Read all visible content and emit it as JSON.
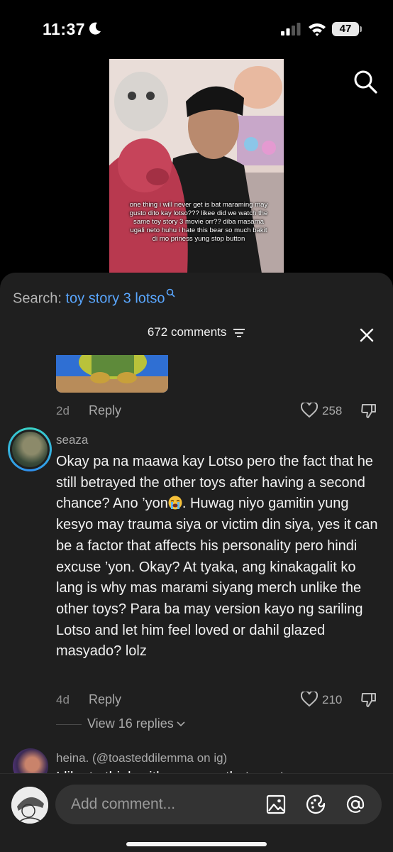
{
  "status_bar": {
    "time": "11:37",
    "battery": "47"
  },
  "video": {
    "caption": "one thing i will never get is bat maraming may gusto dito kay lotso??? likee did we watch the same toy story 3 movie orr?? diba masama ugali neto huhu i hate this bear so much bakit di mo priness yung stop button"
  },
  "sheet": {
    "search_label": "Search:",
    "search_query": "toy story 3 lotso",
    "comments_count": "672 comments"
  },
  "prev_comment": {
    "age": "2d",
    "reply_label": "Reply",
    "likes": "258"
  },
  "comment": {
    "username": "seaza",
    "text_part1": "Okay pa na maawa kay Lotso pero the fact that he still betrayed the other toys after having a second chance? Ano ’yon",
    "text_part2": ". Huwag niyo gamitin yung kesyo may trauma siya or victim din siya, yes it can be a factor that affects his personality pero hindi excuse ’yon. Okay? At tyaka, ang kinakagalit ko lang is why mas marami siyang merch unlike the other toys? Para ba may version kayo ng sariling Lotso and let him feel loved or dahil glazed masyado? lolz",
    "age": "4d",
    "reply_label": "Reply",
    "likes": "210",
    "view_replies": "View 16 replies"
  },
  "next_comment": {
    "username": "heina. (@toasteddilemma on ig)",
    "text": "I like to think with commas that most"
  },
  "input": {
    "placeholder": "Add comment..."
  },
  "colors": {
    "accent_link": "#5aa7ff",
    "sheet_bg": "#1f1f1f",
    "muted_text": "#a9a9a9"
  },
  "icons": [
    "moon-icon",
    "signal-icon",
    "wifi-icon",
    "battery-icon",
    "search-icon",
    "filter-icon",
    "close-icon",
    "heart-icon",
    "dislike-icon",
    "crying-emoji-icon",
    "chevron-down-icon",
    "image-icon",
    "sticker-icon",
    "at-icon"
  ]
}
